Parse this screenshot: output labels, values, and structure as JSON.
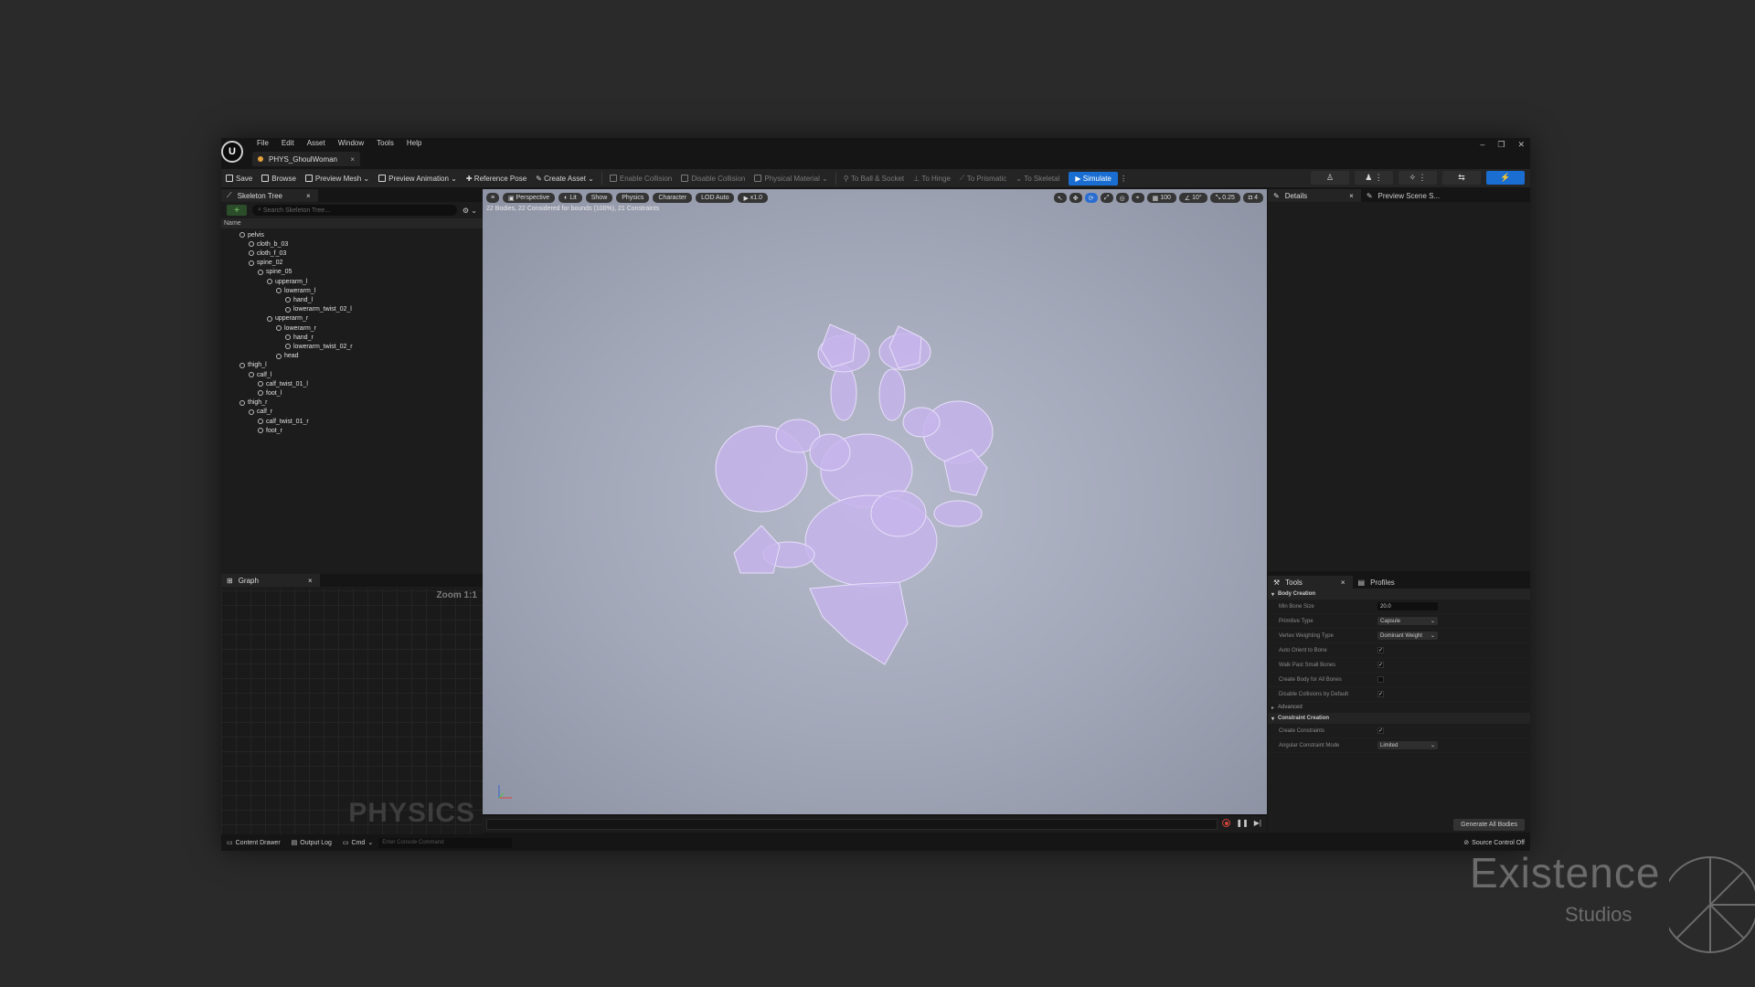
{
  "app": {
    "menu": [
      "File",
      "Edit",
      "Asset",
      "Window",
      "Tools",
      "Help"
    ],
    "document_tab": "PHYS_GhoulWoman",
    "logo_text": "U"
  },
  "toolbar": {
    "save": "Save",
    "browse": "Browse",
    "preview_mesh": "Preview Mesh",
    "preview_animation": "Preview Animation",
    "reference_pose": "Reference Pose",
    "create_asset": "Create Asset",
    "enable_collision": "Enable Collision",
    "disable_collision": "Disable Collision",
    "physical_material": "Physical Material",
    "to_ball_socket": "To Ball & Socket",
    "to_hinge": "To Hinge",
    "to_prismatic": "To Prismatic",
    "to_skeletal": "To Skeletal",
    "simulate": "Simulate"
  },
  "skeleton_tree": {
    "tab": "Skeleton Tree",
    "search_placeholder": "Search Skeleton Tree...",
    "column": "Name",
    "bones": [
      {
        "name": "pelvis",
        "depth": 0
      },
      {
        "name": "cloth_b_03",
        "depth": 1
      },
      {
        "name": "cloth_f_03",
        "depth": 1
      },
      {
        "name": "spine_02",
        "depth": 1
      },
      {
        "name": "spine_05",
        "depth": 2
      },
      {
        "name": "upperarm_l",
        "depth": 3
      },
      {
        "name": "lowerarm_l",
        "depth": 4
      },
      {
        "name": "hand_l",
        "depth": 5
      },
      {
        "name": "lowerarm_twist_02_l",
        "depth": 5
      },
      {
        "name": "upperarm_r",
        "depth": 3
      },
      {
        "name": "lowerarm_r",
        "depth": 4
      },
      {
        "name": "hand_r",
        "depth": 5
      },
      {
        "name": "lowerarm_twist_02_r",
        "depth": 5
      },
      {
        "name": "head",
        "depth": 4
      },
      {
        "name": "thigh_l",
        "depth": 0
      },
      {
        "name": "calf_l",
        "depth": 1
      },
      {
        "name": "calf_twist_01_l",
        "depth": 2
      },
      {
        "name": "foot_l",
        "depth": 2
      },
      {
        "name": "thigh_r",
        "depth": 0
      },
      {
        "name": "calf_r",
        "depth": 1
      },
      {
        "name": "calf_twist_01_r",
        "depth": 2
      },
      {
        "name": "foot_r",
        "depth": 2
      }
    ]
  },
  "graph": {
    "tab": "Graph",
    "zoom": "Zoom 1:1",
    "watermark": "PHYSICS"
  },
  "viewport": {
    "perspective": "Perspective",
    "lit": "Lit",
    "show": "Show",
    "physics": "Physics",
    "character": "Character",
    "lod": "LOD Auto",
    "speed": "x1.0",
    "stats": "22 Bodies, 22 Considered for bounds (100%), 21 Constraints",
    "grid_snap": "100",
    "rot_snap": "10°",
    "scale_snap": "0.25",
    "camera_speed": "4"
  },
  "details": {
    "tab": "Details",
    "tab2": "Preview Scene S..."
  },
  "tools": {
    "tab": "Tools",
    "tab2": "Profiles",
    "body_creation": "Body Creation",
    "min_bone_size_label": "Min Bone Size",
    "min_bone_size": "20.0",
    "primitive_type_label": "Primitive Type",
    "primitive_type": "Capsule",
    "vertex_weighting_label": "Vertex Weighting Type",
    "vertex_weighting": "Dominant Weight",
    "auto_orient_label": "Auto Orient to Bone",
    "walk_past_label": "Walk Past Small Bones",
    "create_body_label": "Create Body for All Bones",
    "disable_collisions_label": "Disable Collisions by Default",
    "advanced": "Advanced",
    "constraint_creation": "Constraint Creation",
    "create_constraints_label": "Create Constraints",
    "angular_mode_label": "Angular Constraint Mode",
    "angular_mode": "Limited",
    "generate": "Generate All Bodies"
  },
  "statusbar": {
    "content_drawer": "Content Drawer",
    "output_log": "Output Log",
    "cmd": "Cmd",
    "console_placeholder": "Enter Console Command",
    "source_control": "Source Control Off"
  },
  "watermark": {
    "line1": "Existence",
    "line2": "Studios"
  },
  "colors": {
    "accent": "#1a6ed1",
    "body_fill": "#c6b4ec"
  }
}
